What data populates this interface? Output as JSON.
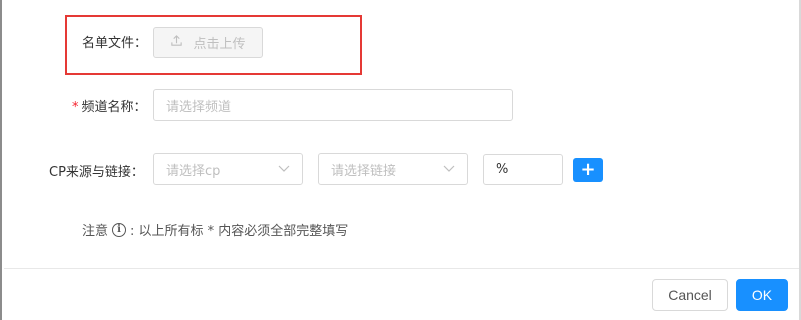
{
  "form": {
    "file_list": {
      "label": "名单文件：",
      "upload_label": "点击上传"
    },
    "channel_name": {
      "required_mark": "*",
      "label": "频道名称：",
      "placeholder": "请选择频道"
    },
    "cp_source": {
      "label": "CP来源与链接：",
      "cp_placeholder": "请选择cp",
      "link_placeholder": "请选择链接",
      "percent_value": "%",
      "add_label": "+"
    },
    "note": {
      "prefix": "注意",
      "text": ": 以上所有标 * 内容必须全部完整填写"
    }
  },
  "footer": {
    "cancel_label": "Cancel",
    "ok_label": "OK"
  },
  "colors": {
    "primary": "#1890ff",
    "highlight": "#e53935",
    "required": "#f5222d",
    "placeholder": "#bfbfbf",
    "border": "#d9d9d9"
  },
  "icons": {
    "upload": "upload-icon",
    "chevron": "chevron-down-icon",
    "info": "info-icon",
    "plus": "plus-icon"
  }
}
